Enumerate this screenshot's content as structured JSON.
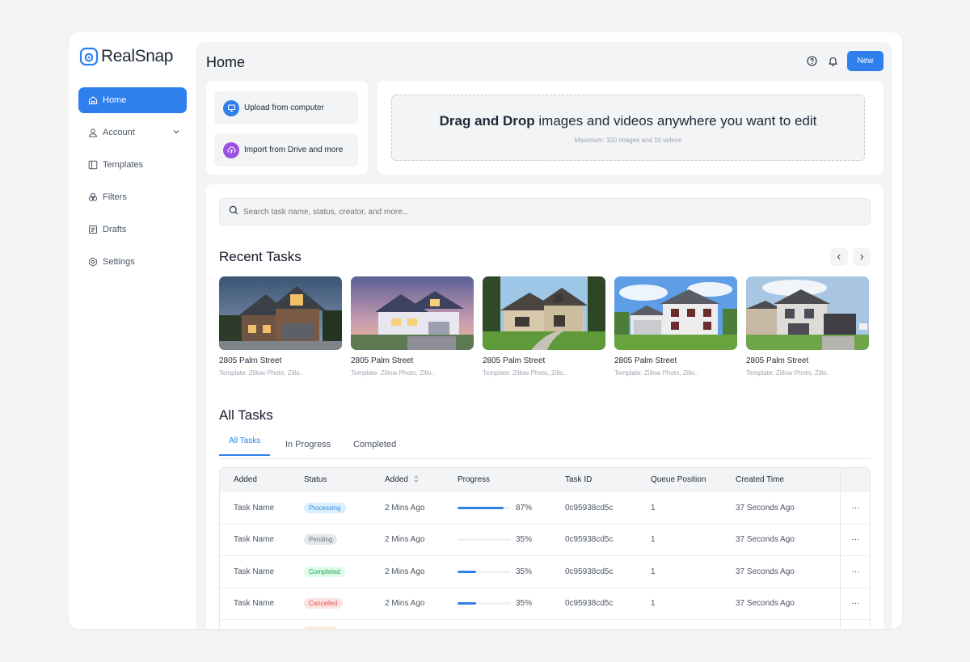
{
  "app": {
    "name": "RealSnap"
  },
  "sidebar": {
    "items": [
      {
        "label": "Home",
        "icon": "home-icon"
      },
      {
        "label": "Account",
        "icon": "user-icon"
      },
      {
        "label": "Templates",
        "icon": "template-icon"
      },
      {
        "label": "Filters",
        "icon": "filter-icon"
      },
      {
        "label": "Drafts",
        "icon": "drafts-icon"
      },
      {
        "label": "Settings",
        "icon": "gear-icon"
      }
    ]
  },
  "header": {
    "title": "Home",
    "new_label": "New"
  },
  "upload": {
    "computer_label": "Upload from computer",
    "drive_label": "Import from Drive and more"
  },
  "dropzone": {
    "title_bold": "Drag and Drop",
    "title_rest": " images and videos anywhere you want to edit",
    "subtitle": "Maximum: 100 images and 10 videos"
  },
  "search": {
    "placeholder": "Search task name, status, creator, and more..."
  },
  "recent": {
    "title": "Recent Tasks",
    "items": [
      {
        "title": "2805 Palm Street",
        "subtitle": "Template: Zillow Photo, Zillo.."
      },
      {
        "title": "2805 Palm Street",
        "subtitle": "Template: Zillow Photo, Zillo.."
      },
      {
        "title": "2805 Palm Street",
        "subtitle": "Template: Zillow Photo, Zillo.."
      },
      {
        "title": "2805 Palm Street",
        "subtitle": "Template: Zillow Photo, Zillo.."
      },
      {
        "title": "2805 Palm Street",
        "subtitle": "Template: Zillow Photo, Zillo.."
      }
    ]
  },
  "all_tasks": {
    "title": "All Tasks",
    "tabs": [
      "All Tasks",
      "In Progress",
      "Completed"
    ],
    "columns": [
      "Added",
      "Status",
      "Added",
      "Progress",
      "Task ID",
      "Queue Position",
      "Created Time"
    ],
    "rows": [
      {
        "name": "Task Name",
        "status": "Processing",
        "added": "2 Mins Ago",
        "progress": 87,
        "progress_label": "87%",
        "task_id": "0c95938cd5c",
        "queue": "1",
        "created": "37 Seconds Ago"
      },
      {
        "name": "Task Name",
        "status": "Pending",
        "added": "2 Mins Ago",
        "progress": 0,
        "progress_label": "35%",
        "task_id": "0c95938cd5c",
        "queue": "1",
        "created": "37 Seconds Ago"
      },
      {
        "name": "Task Name",
        "status": "Completed",
        "added": "2 Mins Ago",
        "progress": 35,
        "progress_label": "35%",
        "task_id": "0c95938cd5c",
        "queue": "1",
        "created": "37 Seconds Ago"
      },
      {
        "name": "Task Name",
        "status": "Cancelled",
        "added": "2 Mins Ago",
        "progress": 35,
        "progress_label": "35%",
        "task_id": "0c95938cd5c",
        "queue": "1",
        "created": "37 Seconds Ago"
      }
    ],
    "more_label": "···"
  },
  "colors": {
    "accent": "#2f80ed",
    "processing": "#dbeefe",
    "pending": "#e5e7eb",
    "completed": "#dcfce7",
    "cancelled": "#fde2e2"
  }
}
